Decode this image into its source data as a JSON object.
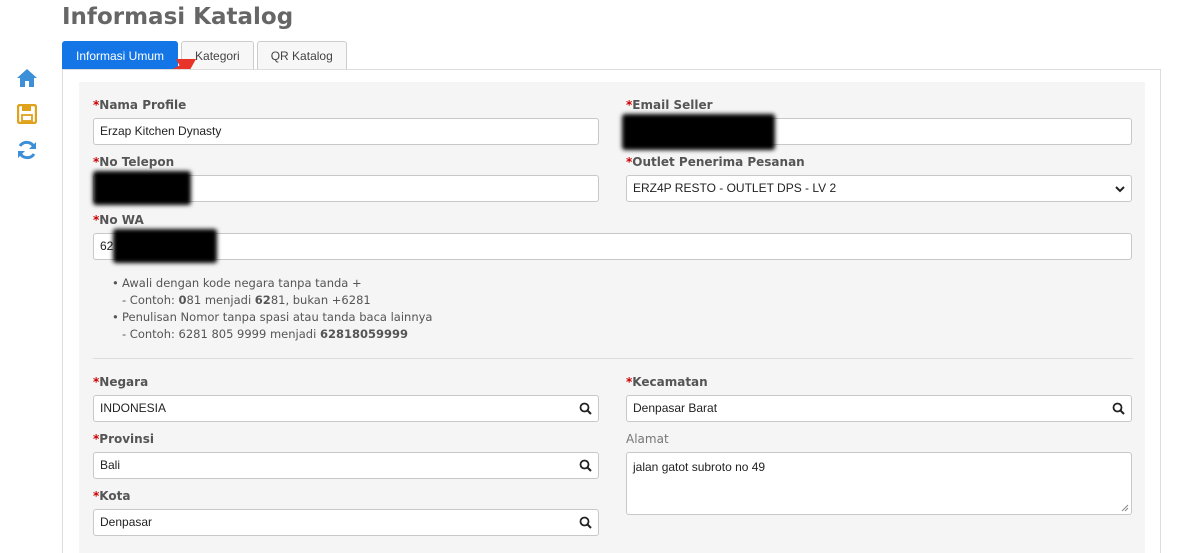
{
  "page": {
    "title": "Informasi Katalog"
  },
  "sidebar": {
    "icons": [
      {
        "name": "home-icon",
        "color": "#3d8fd8"
      },
      {
        "name": "save-icon",
        "color": "#e0a11b"
      },
      {
        "name": "refresh-icon",
        "color": "#3d8fd8"
      }
    ]
  },
  "tabs": [
    {
      "label": "Informasi Umum",
      "active": true
    },
    {
      "label": "Kategori",
      "active": false
    },
    {
      "label": "QR Katalog",
      "active": false
    }
  ],
  "form": {
    "required_mark": "*",
    "nama_profile": {
      "label": "Nama Profile",
      "value": "Erzap Kitchen Dynasty"
    },
    "email_seller": {
      "label": "Email Seller",
      "value": ""
    },
    "no_telepon": {
      "label": "No Telepon",
      "value": ""
    },
    "outlet": {
      "label": "Outlet Penerima Pesanan",
      "value": "ERZ4P RESTO - OUTLET DPS - LV 2"
    },
    "no_wa": {
      "label": "No WA",
      "value": "62"
    },
    "hints": {
      "line1": "Awali dengan kode negara tanpa tanda +",
      "line1_example_prefix": "- Contoh: ",
      "line1_b1": "0",
      "line1_mid": "81 menjadi ",
      "line1_b2": "62",
      "line1_end": "81, bukan +6281",
      "line2": "Penulisan Nomor tanpa spasi atau tanda baca lainnya",
      "line2_example_prefix": "- Contoh: 6281 805 9999 menjadi ",
      "line2_b": "62818059999"
    },
    "negara": {
      "label": "Negara",
      "value": "INDONESIA"
    },
    "kecamatan": {
      "label": "Kecamatan",
      "value": "Denpasar Barat"
    },
    "provinsi": {
      "label": "Provinsi",
      "value": "Bali"
    },
    "alamat": {
      "label": "Alamat",
      "value": "jalan gatot subroto no 49"
    },
    "kota": {
      "label": "Kota",
      "value": "Denpasar"
    }
  },
  "colors": {
    "accent": "#1476e6",
    "required": "#cc0000",
    "arrow": "#e8332a"
  }
}
